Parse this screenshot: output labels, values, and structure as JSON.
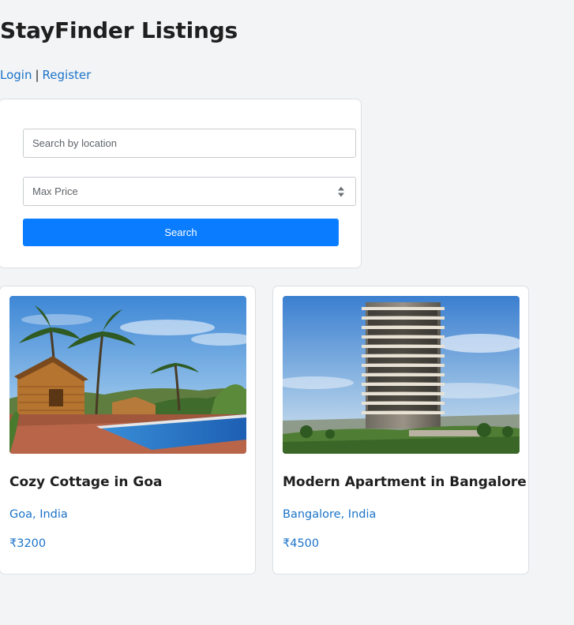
{
  "header": {
    "title": "StayFinder Listings"
  },
  "auth": {
    "login": "Login",
    "separator": "|",
    "register": "Register"
  },
  "search": {
    "location_placeholder": "Search by location",
    "max_price_label": "Max Price",
    "button_label": "Search"
  },
  "listings": [
    {
      "title": "Cozy Cottage in Goa",
      "location": "Goa, India",
      "price": "₹3200",
      "image": "cottage-pool-photo"
    },
    {
      "title": "Modern Apartment in Bangalore",
      "location": "Bangalore, India",
      "price": "₹4500",
      "image": "high-rise-apartment-photo"
    }
  ],
  "colors": {
    "accent": "#0a7cff",
    "link": "#1a73c9",
    "background": "#f3f4f6"
  }
}
